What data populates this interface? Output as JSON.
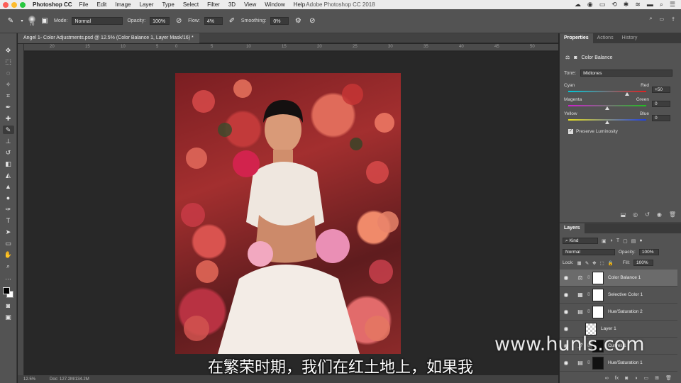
{
  "menubar": {
    "app": "Photoshop CC",
    "items": [
      "File",
      "Edit",
      "Image",
      "Layer",
      "Type",
      "Select",
      "Filter",
      "3D",
      "View",
      "Window",
      "Help"
    ],
    "window_title": "Adobe Photoshop CC 2018"
  },
  "options": {
    "brush_size": "70",
    "mode_label": "Mode:",
    "mode_value": "Normal",
    "opacity_label": "Opacity:",
    "opacity_value": "100%",
    "flow_label": "Flow:",
    "flow_value": "4%",
    "smoothing_label": "Smoothing:",
    "smoothing_value": "0%"
  },
  "document": {
    "tab_title": "Angel 1- Color Adjustments.psd @ 12.5% (Color Balance 1, Layer Mask/16) *",
    "ruler_marks": [
      "20",
      "15",
      "10",
      "5",
      "0",
      "5",
      "10",
      "15",
      "20",
      "25",
      "30",
      "35",
      "40",
      "45",
      "50"
    ],
    "zoom": "12.5%",
    "doc_info": "Doc: 127.2M/134.2M"
  },
  "properties": {
    "tabs": [
      "Properties",
      "Actions",
      "History"
    ],
    "title": "Color Balance",
    "tone_label": "Tone:",
    "tone_value": "Midtones",
    "sliders": [
      {
        "left": "Cyan",
        "right": "Red",
        "value": "+50",
        "pos": 0.75,
        "gradient": "linear-gradient(90deg,#00c8d8,#e02020)"
      },
      {
        "left": "Magenta",
        "right": "Green",
        "value": "0",
        "pos": 0.5,
        "gradient": "linear-gradient(90deg,#d020d0,#20c020)"
      },
      {
        "left": "Yellow",
        "right": "Blue",
        "value": "0",
        "pos": 0.5,
        "gradient": "linear-gradient(90deg,#e8e020,#2040e0)"
      }
    ],
    "preserve_label": "Preserve Luminosity"
  },
  "layers": {
    "tab": "Layers",
    "kind_label": "Kind",
    "blend_mode": "Normal",
    "opacity_label": "Opacity:",
    "opacity_value": "100%",
    "lock_label": "Lock:",
    "fill_label": "Fill:",
    "fill_value": "100%",
    "items": [
      {
        "name": "Color Balance 1",
        "type": "adjustment",
        "icon": "balance-icon",
        "selected": true
      },
      {
        "name": "Selective Color 1",
        "type": "adjustment",
        "icon": "selective-color-icon",
        "selected": false
      },
      {
        "name": "Hue/Saturation 2",
        "type": "adjustment",
        "icon": "hue-saturation-icon",
        "selected": false
      },
      {
        "name": "Layer 1",
        "type": "pixel",
        "icon": "",
        "selected": false
      },
      {
        "name": "Curves 1",
        "type": "adjustment",
        "icon": "curves-icon",
        "selected": false
      },
      {
        "name": "Hue/Saturation 1",
        "type": "adjustment",
        "icon": "hue-saturation-icon",
        "selected": false
      }
    ]
  },
  "overlay": {
    "subtitle": "在繁荣时期，我们在红土地上，如果我",
    "watermark": "www.hunls.com"
  }
}
